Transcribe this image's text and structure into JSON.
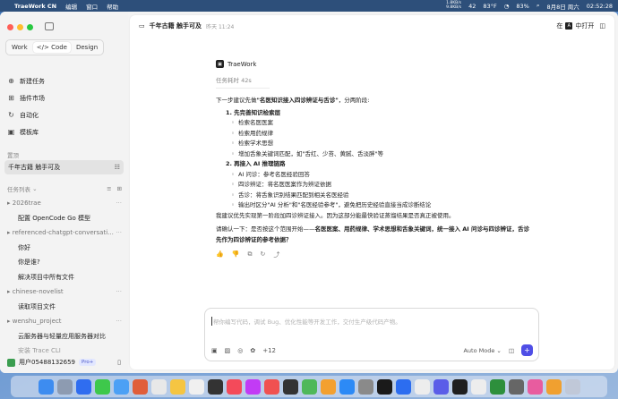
{
  "menubar": {
    "app_name": "TraeWork CN",
    "menus": [
      "编辑",
      "窗口",
      "帮助"
    ],
    "net_up": "1.8KB/s",
    "net_down": "9.8KB/s",
    "temp_badge": "42",
    "weather": "83°F",
    "battery": "83%",
    "date": "8月8日 周六",
    "time": "02:52:28"
  },
  "sidebar": {
    "modes": [
      "Work",
      "Code",
      "Design"
    ],
    "active_mode": "Code",
    "nav": [
      {
        "icon": "plus-circle-icon",
        "label": "新建任务"
      },
      {
        "icon": "grid-icon",
        "label": "插件市场"
      },
      {
        "icon": "refresh-icon",
        "label": "自动化"
      },
      {
        "icon": "template-icon",
        "label": "模板库"
      }
    ],
    "pinned_label": "置顶",
    "pinned_task": "千年古籍 触手可及",
    "tasks_label": "任务列表",
    "groups": [
      {
        "name": "2026trae",
        "tasks": [
          "配置 OpenCode Go 模型"
        ]
      },
      {
        "name": "referenced-chatgpt-conversati...",
        "tasks": [
          "你好",
          "你是谁?",
          "解决项目中所有文件"
        ]
      },
      {
        "name": "chinese-novelist",
        "tasks": [
          "读取项目文件"
        ]
      },
      {
        "name": "wenshu_project",
        "tasks": [
          "云服务器与轻量应用服务器对比",
          "安装 Trace CLI"
        ]
      }
    ],
    "user": "用户05488132659",
    "pro_badge": "Pro+"
  },
  "topbar": {
    "title": "千年古籍 触手可及",
    "time": "昨天 11:24",
    "open_label": "中打开",
    "open_prefix": "在"
  },
  "conversation": {
    "brand": "TraeWork",
    "elapsed": "任务耗时 42s",
    "intro": "下一步建议先做",
    "intro_bold": "\"名医知识接入四诊辨证与舌诊\"",
    "intro_tail": "，分两阶段:",
    "step1_num": "1.",
    "step1_title": "先完善知识检索层",
    "step1_items": [
      "检索名医医案",
      "检索用药规律",
      "检索学术思想",
      "增加舌象关键词匹配，如\"舌红、少苔、黄腻、舌淡胖\"等"
    ],
    "step2_num": "2.",
    "step2_title": "再接入 AI 推理链路",
    "step2_items": [
      "AI 问诊：参考名医经验回答",
      "四诊辨证：将名医医案作为辨证依据",
      "舌诊：将舌象识别结果匹配到相关名医经验",
      "输出时区分\"AI 分析\"和\"名医经验参考\"，避免把历史经验直接当成诊断结论"
    ],
    "recommend": "我建议优先实现第一阶段加四诊辨证接入。因为这部分能最快验证蒸馏结果是否真正被使用。",
    "confirm_a": "请确认一下：是否按这个范围开始——",
    "confirm_b": "名医医案、用药规律、学术思想和舌象关键词，统一接入 AI 问诊与四诊辨证，舌诊先作为四诊辨证的参考依据？"
  },
  "composer": {
    "placeholder": "帮你编写代码，调试 Bug、优化性能等开发工作，交付生产级代码产物。",
    "plus_count": "+12",
    "mode": "Auto Mode"
  },
  "colors": {
    "accent": "#4f4ee6",
    "sidebar_bg": "#f3f3f3",
    "pro_text": "#4a57c9"
  }
}
